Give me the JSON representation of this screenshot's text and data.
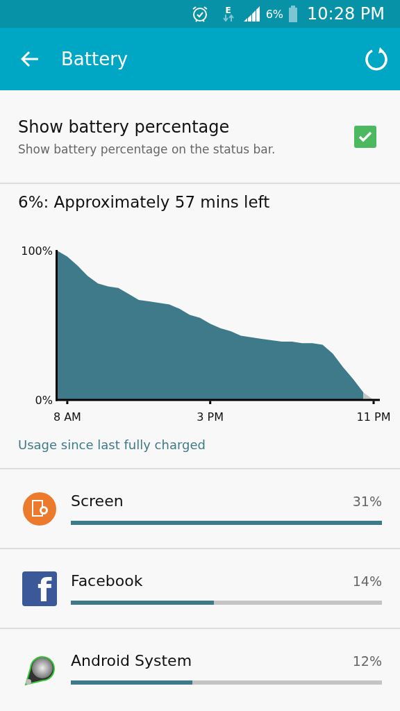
{
  "status_bar": {
    "network": "E",
    "battery_percent": "6%",
    "time": "10:28 PM"
  },
  "app_bar": {
    "title": "Battery"
  },
  "setting": {
    "title": "Show battery percentage",
    "summary": "Show battery percentage on the status bar.",
    "checked": true
  },
  "estimate": "6%: Approximately 57 mins left",
  "chart": {
    "chart_data": {
      "type": "area",
      "categories": [
        null,
        "8 AM",
        null,
        null,
        null,
        null,
        null,
        null,
        null,
        null,
        null,
        null,
        null,
        null,
        null,
        "3 PM",
        null,
        null,
        null,
        null,
        null,
        null,
        null,
        null,
        null,
        null,
        null,
        null,
        null,
        null,
        null,
        "11 PM"
      ],
      "series": [
        {
          "color": "#3e7a89",
          "values": [
            100,
            96,
            90,
            83,
            78,
            76,
            75,
            71,
            67,
            66,
            65,
            64,
            61,
            57,
            55,
            51,
            48,
            46,
            43,
            42,
            41,
            40,
            39,
            39,
            38,
            38,
            37,
            31,
            22,
            14,
            5,
            null
          ]
        },
        {
          "color": "#c4c4c4",
          "values": [
            null,
            null,
            null,
            null,
            null,
            null,
            null,
            null,
            null,
            null,
            null,
            null,
            null,
            null,
            null,
            null,
            null,
            null,
            null,
            null,
            null,
            null,
            null,
            null,
            null,
            null,
            null,
            null,
            null,
            null,
            5,
            0
          ]
        }
      ],
      "ylim": [
        0,
        100
      ],
      "yticks": [
        {
          "value": 0,
          "label": "0%"
        },
        {
          "value": 100,
          "label": "100%"
        }
      ]
    }
  },
  "usage_link": "Usage since last fully charged",
  "usage": [
    {
      "kind": "screen",
      "name": "Screen",
      "percent": "31%",
      "level": 1.0
    },
    {
      "kind": "letter",
      "letter": "f",
      "name": "Facebook",
      "percent": "14%",
      "level": 0.46
    },
    {
      "kind": "system",
      "name": "Android System",
      "percent": "12%",
      "level": 0.39
    }
  ]
}
